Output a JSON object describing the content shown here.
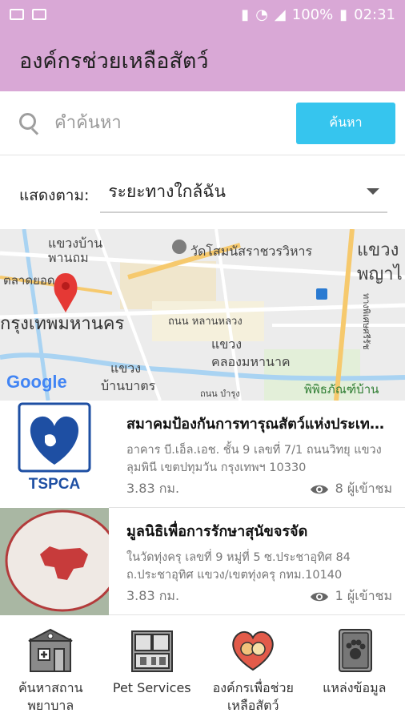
{
  "status_bar": {
    "battery": "100%",
    "time": "02:31"
  },
  "app_bar": {
    "title": "องค์กรช่วยเหลือสัตว์"
  },
  "search": {
    "placeholder": "คำค้นหา",
    "value": "",
    "button_label": "ค้นหา"
  },
  "sort": {
    "label": "แสดงตาม:",
    "selected": "ระยะทางใกล้ฉัน"
  },
  "map": {
    "labels": {
      "area_top_left": "แขวงบ้าน",
      "area_top_left2": "พานถม",
      "market": "ตลาดยอด",
      "temple": "วัดโสมนัสราชวรวิหาร",
      "area_right": "แขวง",
      "area_right2": "พญาไ",
      "city": "กรุงเทพมหานคร",
      "road": "ถนน หลานหลวง",
      "area_center": "แขวง",
      "area_center2": "คลองมหานาค",
      "area_bottom": "แขวง",
      "area_bottom2": "บ้านบาตร",
      "museum": "พิพิธภัณฑ์บ้าน",
      "road_right": "ทางพิเศษศรีรัช",
      "road_bottom": "ถนน บำรุง"
    },
    "attribution": "Google",
    "colors": {
      "pin": "#e53935",
      "road_major": "#f6c96d",
      "water": "#a9d3f2"
    }
  },
  "results": [
    {
      "title": "สมาคมป้องกันการทารุณสัตว์แห่งประเทศไทย",
      "address": "อาคาร บี.เอ็ล.เอช. ชั้น 9 เลขที่ 7/1 ถนนวิทยุ แขวงลุมพินี เขตปทุมวัน กรุงเทพฯ 10330",
      "distance": "3.83 กม.",
      "views": "8 ผู้เข้าชม",
      "logo_text": "TSPCA"
    },
    {
      "title": "มูลนิธิเพื่อการรักษาสุนัขจรจัด",
      "address": "ในวัดทุ่งครุ เลขที่ 9 หมู่ที่ 5  ซ.ประชาอุทิศ 84 ถ.ประชาอุทิศ แขวง/เขตทุ่งครุ กทม.10140",
      "distance": "3.83 กม.",
      "views": "1 ผู้เข้าชม"
    }
  ],
  "bottom_nav": [
    {
      "label": "ค้นหาสถาน\nพยาบาล",
      "icon": "hospital-icon"
    },
    {
      "label": "Pet Services",
      "icon": "pet-shop-icon"
    },
    {
      "label": "องค์กรเพื่อช่วย\nเหลือสัตว์",
      "icon": "heart-pets-icon"
    },
    {
      "label": "แหล่งข้อมูล",
      "icon": "paw-book-icon"
    }
  ]
}
